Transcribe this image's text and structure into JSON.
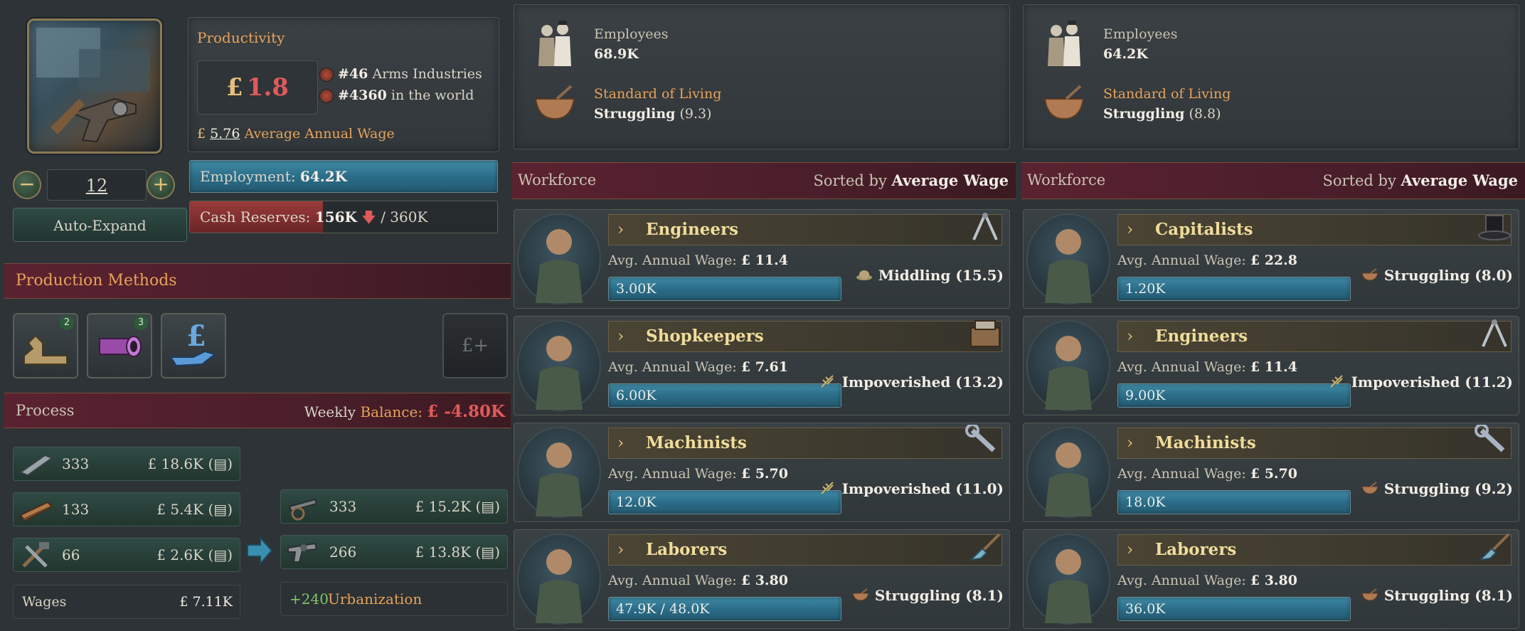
{
  "building": {
    "level": "12",
    "auto_expand_label": "Auto-Expand",
    "productivity_label": "Productivity",
    "productivity_currency": "£",
    "productivity_value": "1.8",
    "rank_industry_num": "#46",
    "rank_industry_label": "Arms Industries",
    "rank_world_num": "#4360",
    "rank_world_label": "in the world",
    "avg_wage_currency": "£",
    "avg_wage_value": "5.76",
    "avg_wage_label": "Average Annual Wage",
    "employment_label": "Employment:",
    "employment_value": "64.2K",
    "cash_label": "Cash Reserves:",
    "cash_value": "156K",
    "cash_max": "/ 360K",
    "cash_fill_fraction": 0.433
  },
  "production_methods": {
    "title": "Production Methods",
    "items": [
      {
        "icon": "woodworking-icon",
        "badge": "2"
      },
      {
        "icon": "pipe-icon",
        "badge": "3"
      },
      {
        "icon": "pound-hand-icon",
        "badge": ""
      }
    ],
    "add_icon_label": "£+"
  },
  "process": {
    "title": "Process",
    "balance_label_a": "Weekly",
    "balance_label_b": "Balance:",
    "balance_value": "£ -4.80K",
    "inputs": [
      {
        "icon": "steel-icon",
        "qty": "333",
        "value": "£ 18.6K"
      },
      {
        "icon": "wood-icon",
        "qty": "133",
        "value": "£ 5.4K"
      },
      {
        "icon": "tools-icon",
        "qty": "66",
        "value": "£ 2.6K"
      }
    ],
    "outputs": [
      {
        "icon": "artillery-icon",
        "qty": "333",
        "value": "£ 15.2K"
      },
      {
        "icon": "revolver-icon",
        "qty": "266",
        "value": "£ 13.8K"
      }
    ],
    "wages_label": "Wages",
    "wages_value": "£ 7.11K",
    "urbanization_value": "+240",
    "urbanization_label": "Urbanization"
  },
  "columns": [
    {
      "employees_label": "Employees",
      "employees_value": "68.9K",
      "sol_label": "Standard of Living",
      "sol_value": "Struggling",
      "sol_score": "(9.3)",
      "workforce_label": "Workforce",
      "sorted_label": "Sorted by",
      "sorted_value": "Average Wage",
      "pops": [
        {
          "name": "Engineers",
          "wage_label": "Avg. Annual Wage:",
          "wage": "£ 11.4",
          "count": "3.00K",
          "fill": 1.0,
          "sol": "Middling (15.5)",
          "icon": "compass-icon",
          "sol_icon": "hat-icon"
        },
        {
          "name": "Shopkeepers",
          "wage_label": "Avg. Annual Wage:",
          "wage": "£ 7.61",
          "count": "6.00K",
          "fill": 1.0,
          "sol": "Impoverished (13.2)",
          "icon": "cash-register-icon",
          "sol_icon": "wheat-icon"
        },
        {
          "name": "Machinists",
          "wage_label": "Avg. Annual Wage:",
          "wage": "£ 5.70",
          "count": "12.0K",
          "fill": 1.0,
          "sol": "Impoverished (11.0)",
          "icon": "wrench-icon",
          "sol_icon": "wheat-icon"
        },
        {
          "name": "Laborers",
          "wage_label": "Avg. Annual Wage:",
          "wage": "£ 3.80",
          "count": "47.9K / 48.0K",
          "fill": 0.998,
          "sol": "Struggling (8.1)",
          "icon": "shovel-icon",
          "sol_icon": "bowl-icon"
        }
      ]
    },
    {
      "employees_label": "Employees",
      "employees_value": "64.2K",
      "sol_label": "Standard of Living",
      "sol_value": "Struggling",
      "sol_score": "(8.8)",
      "workforce_label": "Workforce",
      "sorted_label": "Sorted by",
      "sorted_value": "Average Wage",
      "pops": [
        {
          "name": "Capitalists",
          "wage_label": "Avg. Annual Wage:",
          "wage": "£ 22.8",
          "count": "1.20K",
          "fill": 1.0,
          "sol": "Struggling (8.0)",
          "icon": "top-hat-icon",
          "sol_icon": "bowl-icon"
        },
        {
          "name": "Engineers",
          "wage_label": "Avg. Annual Wage:",
          "wage": "£ 11.4",
          "count": "9.00K",
          "fill": 1.0,
          "sol": "Impoverished (11.2)",
          "icon": "compass-icon",
          "sol_icon": "wheat-icon"
        },
        {
          "name": "Machinists",
          "wage_label": "Avg. Annual Wage:",
          "wage": "£ 5.70",
          "count": "18.0K",
          "fill": 1.0,
          "sol": "Struggling (9.2)",
          "icon": "wrench-icon",
          "sol_icon": "bowl-icon"
        },
        {
          "name": "Laborers",
          "wage_label": "Avg. Annual Wage:",
          "wage": "£ 3.80",
          "count": "36.0K",
          "fill": 1.0,
          "sol": "Struggling (8.1)",
          "icon": "shovel-icon",
          "sol_icon": "bowl-icon"
        }
      ]
    }
  ]
}
